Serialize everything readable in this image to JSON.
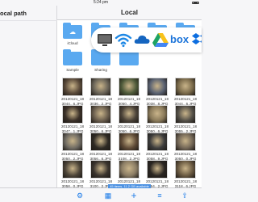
{
  "status": {
    "time": "5:24 pm"
  },
  "sidebar": {
    "title": "ocal path"
  },
  "nav": {
    "title": "Local",
    "edit": "Edit"
  },
  "folders": [
    {
      "label": "iCloud",
      "glyph": "cloud-icon"
    },
    {
      "label": "",
      "glyph": "folder"
    },
    {
      "label": "",
      "glyph": "folder"
    },
    {
      "label": "",
      "glyph": "folder"
    },
    {
      "label": "Import",
      "glyph": "folder"
    },
    {
      "label": "Sample",
      "glyph": "folder"
    },
    {
      "label": "Sharing",
      "glyph": "folder"
    },
    {
      "label": "",
      "glyph": "folder"
    }
  ],
  "photos": [
    {
      "label": "20120121_18\n3044...6.JPG",
      "color": "#5a4a3a"
    },
    {
      "label": "20120121_18\n3036...2.JPG",
      "color": "#6a6458"
    },
    {
      "label": "20120121_18\n3050...4.JPG",
      "color": "#4e5a3a"
    },
    {
      "label": "20120121_18\n3038...8.JPG",
      "color": "#5a6272"
    },
    {
      "label": "20120121_18\n3044...6.JPG",
      "color": "#7a6a4a"
    },
    {
      "label": "20120121_18\n3047...1.JPG",
      "color": "#3a3028"
    },
    {
      "label": "20120121_18\n3050...6.JPG",
      "color": "#6a5e4e"
    },
    {
      "label": "20120121_18\n3050...6.JPG",
      "color": "#4a4238"
    },
    {
      "label": "20120121_18\n3050...6.JPG",
      "color": "#8a7a5a"
    },
    {
      "label": "20120121_18\n3055...2.JPG",
      "color": "#545048"
    },
    {
      "label": "20120121_18\n3050...2.JPG",
      "color": "#6e6a62"
    },
    {
      "label": "20120121_18\n3056...6.JPG",
      "color": "#2e2a24"
    },
    {
      "label": "20120121_18\n3108...2.JPG",
      "color": "#5e4a36"
    },
    {
      "label": "20120121_18\n3058...9.JPG",
      "color": "#3c3c3c"
    },
    {
      "label": "20120121_18\n3050...0.JPG",
      "color": "#726656"
    },
    {
      "label": "20120121_18\n3058...0.JPG",
      "color": "#4c4438"
    },
    {
      "label": "20120121_18\n3100...2.JPG",
      "color": "#3a342e"
    },
    {
      "label": "20120121_18\n3100...2.JPG",
      "color": "#8a7c64"
    },
    {
      "label": "20120121_18\n3154...2.JPG",
      "color": "#2a2622"
    },
    {
      "label": "20120121_18\n3118...6.JPG",
      "color": "#6a5a42"
    },
    {
      "label": "",
      "color": "#5a5048"
    },
    {
      "label": "",
      "color": "#3e3a34"
    },
    {
      "label": "",
      "color": "#6e6656"
    },
    {
      "label": "",
      "color": "#4a4036"
    },
    {
      "label": "",
      "color": "#2c2824"
    }
  ],
  "footer": {
    "info": "45 items, 11.2 GB available"
  },
  "services": [
    "apple-tv-icon",
    "wifi-icon",
    "onedrive-icon",
    "google-drive-icon",
    "box-icon",
    "dropbox-icon"
  ]
}
